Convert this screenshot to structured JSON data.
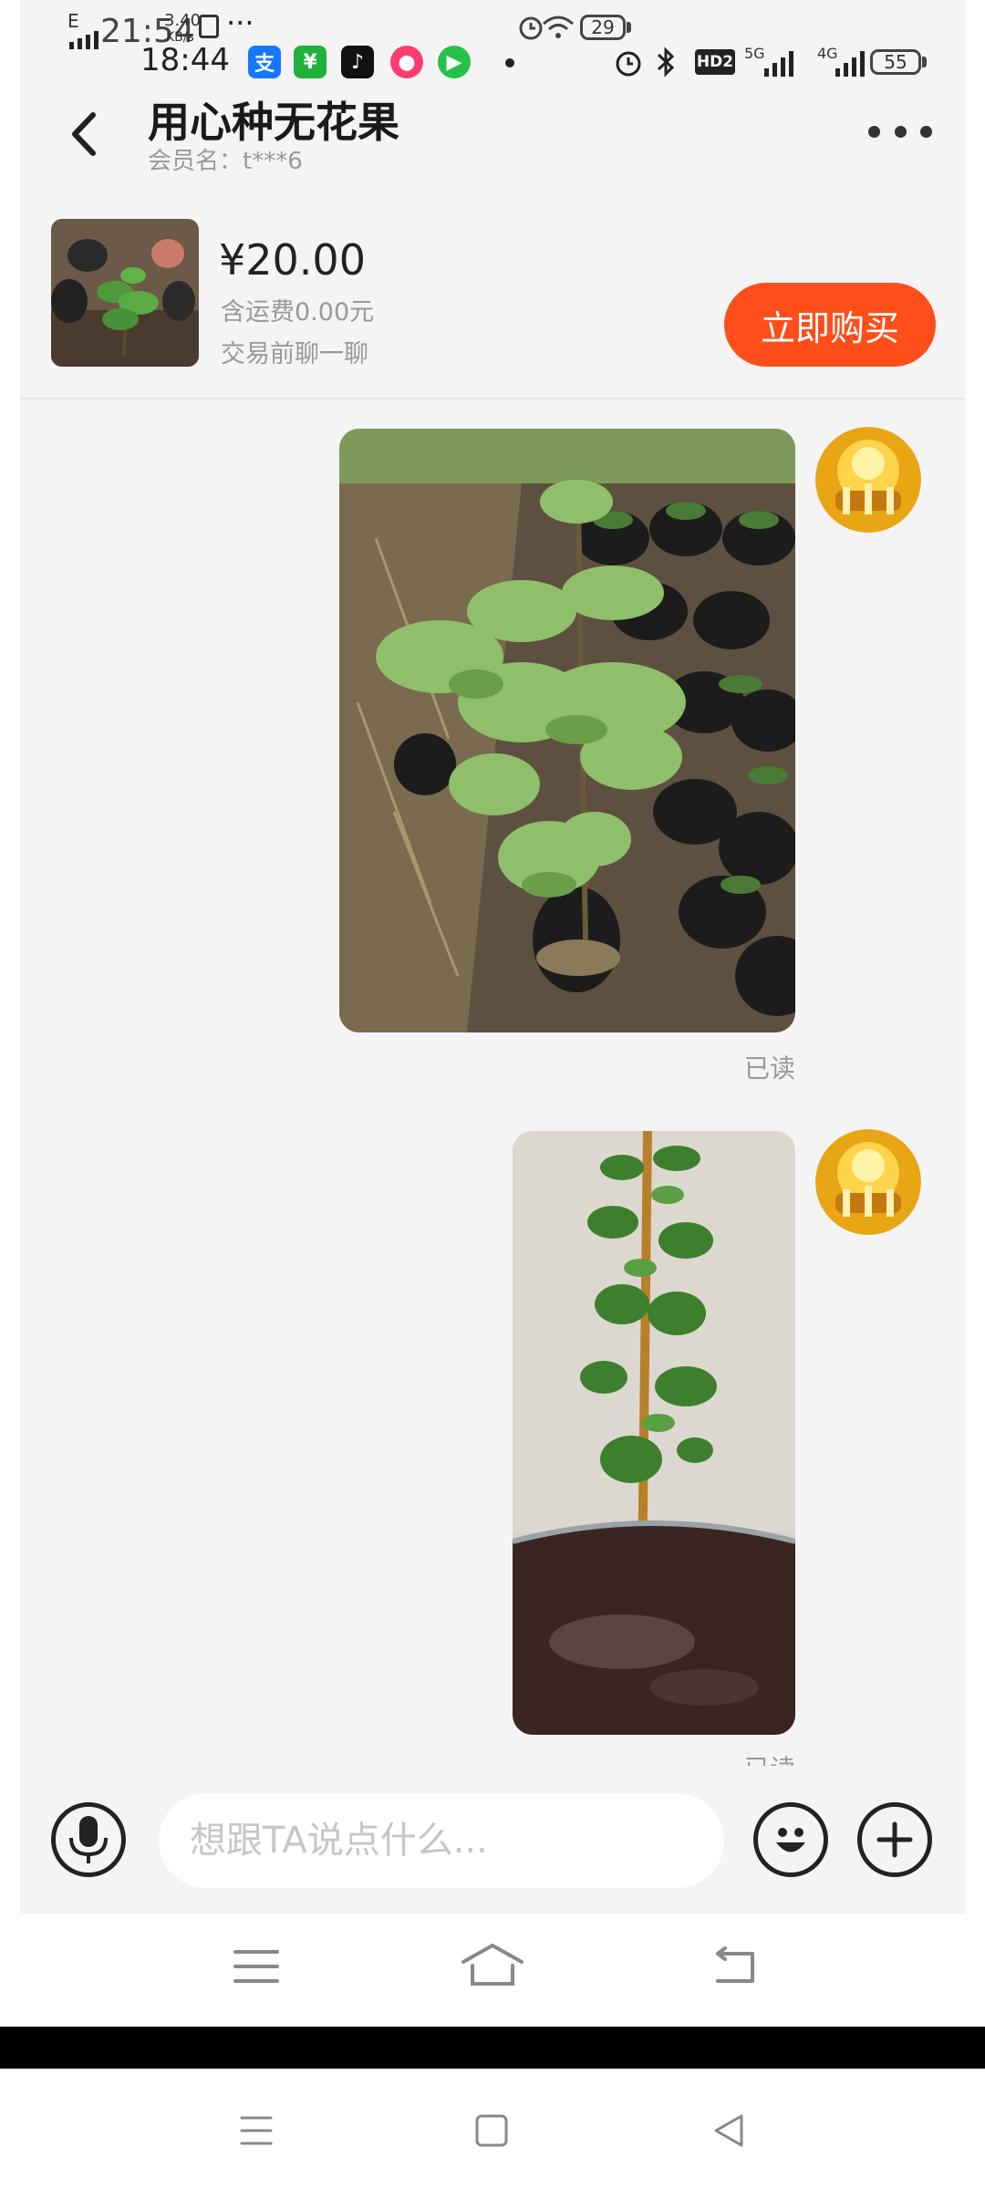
{
  "status_bar_outer": {
    "network_label": "E",
    "time": "21:54",
    "speed_value": "3.40",
    "speed_unit": "KB/s",
    "dots": "···",
    "battery": "29"
  },
  "status_bar_inner": {
    "time": "18:44",
    "hd_badge": "HD2",
    "signal_1": "5G",
    "signal_2": "4G",
    "battery": "55",
    "apps": [
      "alipay",
      "taobao-shop",
      "tiktok",
      "weibo",
      "video"
    ]
  },
  "header": {
    "title": "用心种无花果",
    "subtitle": "会员名：t***6"
  },
  "product": {
    "price": "¥20.00",
    "shipping": "含运费0.00元",
    "chat_hint": "交易前聊一聊",
    "buy_label": "立即购买"
  },
  "messages": [
    {
      "type": "image",
      "subject": "fig-seedling-nursery",
      "read_label": "已读"
    },
    {
      "type": "image",
      "subject": "fig-seedling-pot",
      "read_label": "已读"
    }
  ],
  "input": {
    "placeholder": "想跟TA说点什么..."
  },
  "colors": {
    "accent": "#ff4e1a",
    "background": "#f4f4f5",
    "muted_text": "#999999"
  },
  "icons": [
    "back-icon",
    "more-icon",
    "microphone-icon",
    "emoji-icon",
    "plus-icon",
    "menu-icon",
    "home-icon",
    "back-return-icon",
    "square-icon",
    "triangle-back-icon"
  ]
}
